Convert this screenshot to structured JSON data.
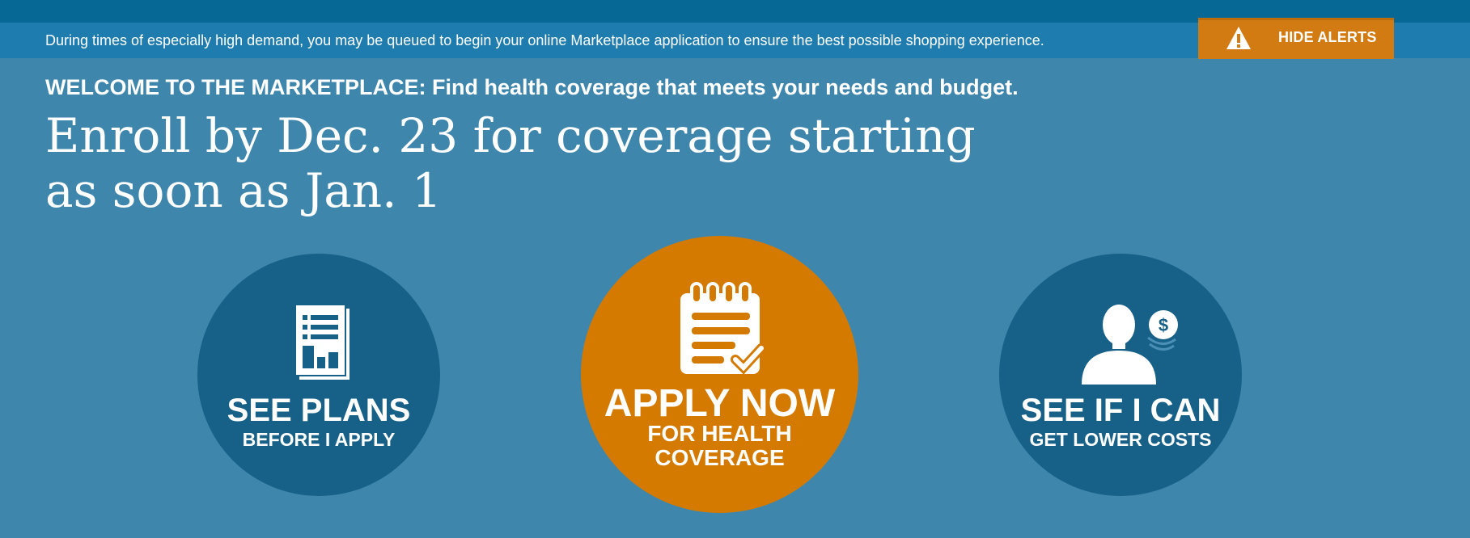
{
  "alert": {
    "message": "During times of especially high demand, you may be queued to begin your online Marketplace application to ensure the best possible shopping experience.",
    "hide_label": "HIDE ALERTS",
    "icon": "warning-icon"
  },
  "hero": {
    "welcome": "WELCOME TO THE MARKETPLACE: Find health coverage that meets your needs and budget.",
    "headline_line1": "Enroll by Dec. 23 for coverage starting",
    "headline_line2": "as soon as Jan. 1"
  },
  "actions": [
    {
      "title": "SEE PLANS",
      "subtitle": "BEFORE I APPLY",
      "icon": "plans-document-icon"
    },
    {
      "title": "APPLY NOW",
      "subtitle": "FOR HEALTH COVERAGE",
      "icon": "application-checklist-icon"
    },
    {
      "title": "SEE IF I CAN",
      "subtitle": "GET LOWER COSTS",
      "icon": "person-savings-icon"
    }
  ],
  "colors": {
    "background": "#3f86ad",
    "top_bar": "#066894",
    "alert_bar": "#1f7cae",
    "accent_orange": "#d47a00",
    "circle_blue": "#176188",
    "text": "#ffffff"
  }
}
